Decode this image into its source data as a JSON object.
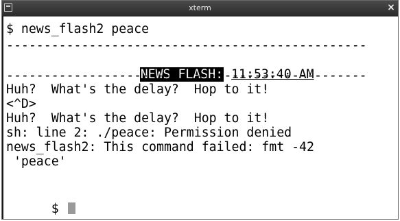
{
  "window": {
    "title": "xterm",
    "close_glyph": "×"
  },
  "terminal": {
    "command_line": "$ news_flash2 peace",
    "rule": "------------------------------------------------",
    "banner_label": "NEWS FLASH:",
    "banner_time": "11:53:40 AM",
    "lines": [
      "Huh?  What's the delay?  Hop to it!",
      "<^D>",
      "Huh?  What's the delay?  Hop to it!",
      "sh: line 2: ./peace: Permission denied",
      "news_flash2: This command failed: fmt -42",
      " 'peace'"
    ],
    "prompt": "$ "
  }
}
